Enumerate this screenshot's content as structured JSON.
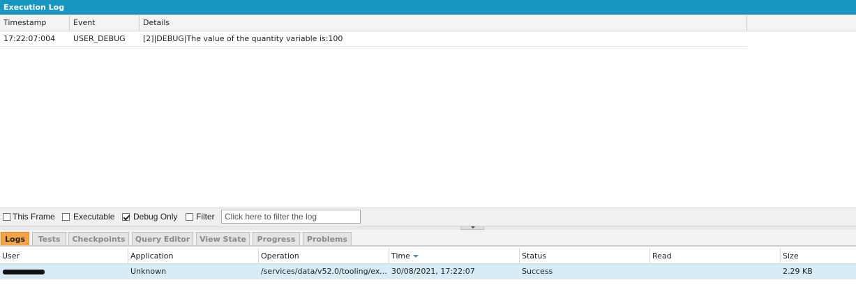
{
  "panel": {
    "title": "Execution Log"
  },
  "log": {
    "columns": [
      "Timestamp",
      "Event",
      "Details"
    ],
    "rows": [
      {
        "timestamp": "17:22:07:004",
        "event": "USER_DEBUG",
        "details": "[2]|DEBUG|The value of the quantity variable is:100"
      }
    ]
  },
  "filters": {
    "this_frame": {
      "label": "This Frame",
      "checked": false
    },
    "executable": {
      "label": "Executable",
      "checked": false
    },
    "debug_only": {
      "label": "Debug Only",
      "checked": true
    },
    "filter": {
      "label": "Filter",
      "checked": false
    },
    "filter_placeholder": "Click here to filter the log"
  },
  "tabs": [
    {
      "label": "Logs",
      "active": true
    },
    {
      "label": "Tests",
      "active": false
    },
    {
      "label": "Checkpoints",
      "active": false
    },
    {
      "label": "Query Editor",
      "active": false
    },
    {
      "label": "View State",
      "active": false
    },
    {
      "label": "Progress",
      "active": false
    },
    {
      "label": "Problems",
      "active": false
    }
  ],
  "logs_grid": {
    "columns": [
      "User",
      "Application",
      "Operation",
      "Time",
      "Status",
      "Read",
      "Size"
    ],
    "sorted_column": "Time",
    "rows": [
      {
        "user": "",
        "application": "Unknown",
        "operation": "/services/data/v52.0/tooling/exec…",
        "time": "30/08/2021, 17:22:07",
        "status": "Success",
        "read": "",
        "size": "2.29 KB"
      }
    ]
  },
  "colors": {
    "title_bar": "#1797c0",
    "active_tab": "#f8a340",
    "selected_row": "#d7ecf7"
  }
}
